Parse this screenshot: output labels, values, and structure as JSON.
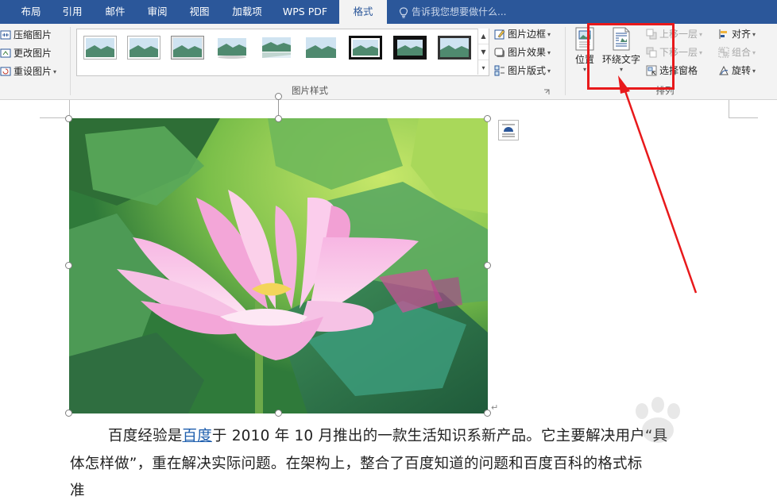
{
  "tabs": [
    "布局",
    "引用",
    "邮件",
    "审阅",
    "视图",
    "加载项",
    "WPS PDF",
    "格式"
  ],
  "active_tab": "格式",
  "tell_me": "告诉我您想要做什么...",
  "adjust_group": {
    "compress": "压缩图片",
    "change": "更改图片",
    "reset": "重设图片"
  },
  "picture_styles": {
    "label": "图片样式",
    "border": "图片边框",
    "effects": "图片效果",
    "layout": "图片版式"
  },
  "arrange_group": {
    "label": "排列",
    "position": "位置",
    "wrap_text": "环绕文字",
    "bring_forward": "上移一层",
    "send_backward": "下移一层",
    "selection_pane": "选择窗格",
    "align": "对齐",
    "group": "组合",
    "rotate": "旋转"
  },
  "document": {
    "line1_a": "百度经验是",
    "line1_link": "百度",
    "line1_b": "于 2010 年 10 月推出的一款生活知识系新产品。它主要解决用户“具",
    "line2": "体怎样做”，重在解决实际问题。在架构上，整合了百度知道的问题和百度百科的格式标",
    "line3": "准"
  },
  "colors": {
    "tab_bar": "#2b579a",
    "ribbon": "#f3f3f3",
    "highlight": "#e8191b",
    "link": "#1f5fae"
  }
}
